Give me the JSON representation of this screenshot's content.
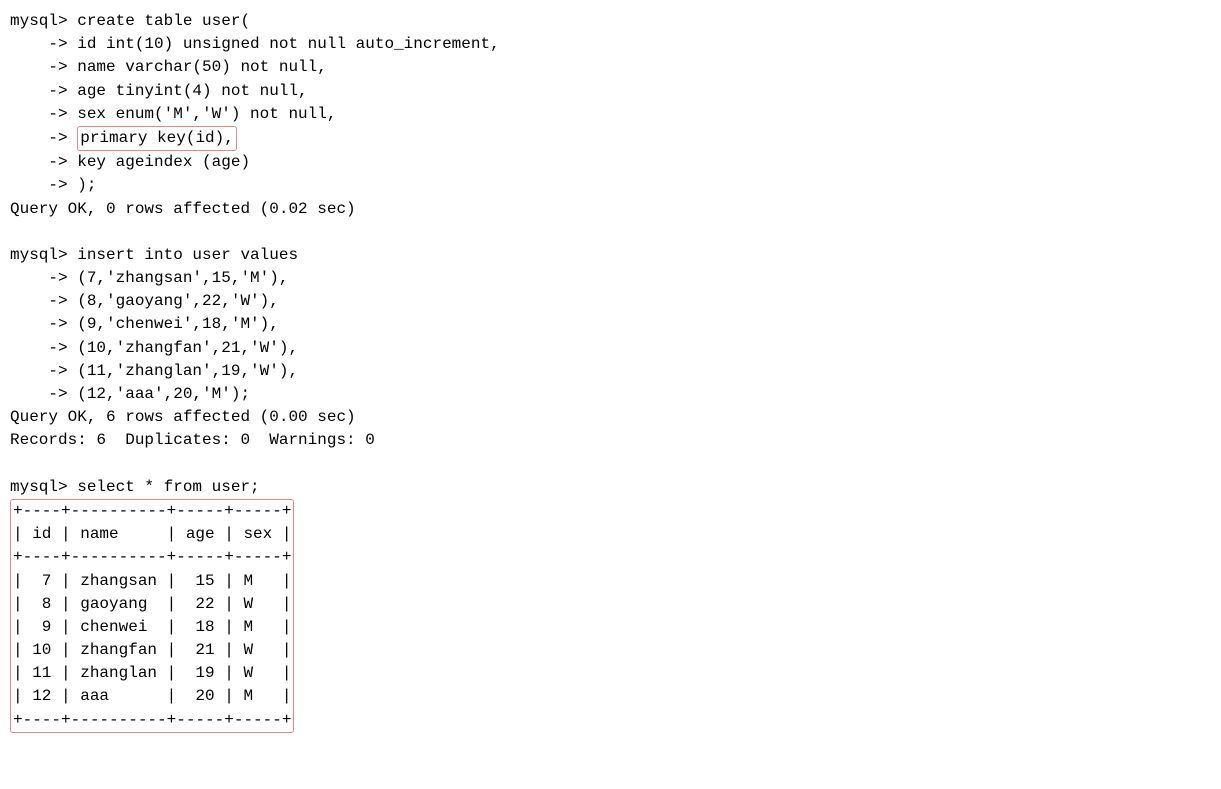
{
  "prompt": "mysql>",
  "cont": "    ->",
  "create": {
    "line1": "mysql> create table user(",
    "line2": "    -> id int(10) unsigned not null auto_increment,",
    "line3": "    -> name varchar(50) not null,",
    "line4": "    -> age tinyint(4) not null,",
    "line5": "    -> sex enum('M','W') not null,",
    "line6_prefix": "    -> ",
    "line6_boxed": "primary key(id),",
    "line7": "    -> key ageindex (age)",
    "line8": "    -> );",
    "result": "Query OK, 0 rows affected (0.02 sec)"
  },
  "insert": {
    "line1": "mysql> insert into user values",
    "line2": "    -> (7,'zhangsan',15,'M'),",
    "line3": "    -> (8,'gaoyang',22,'W'),",
    "line4": "    -> (9,'chenwei',18,'M'),",
    "line5": "    -> (10,'zhangfan',21,'W'),",
    "line6": "    -> (11,'zhanglan',19,'W'),",
    "line7": "    -> (12,'aaa',20,'M');",
    "result1": "Query OK, 6 rows affected (0.00 sec)",
    "result2": "Records: 6  Duplicates: 0  Warnings: 0"
  },
  "select": {
    "query": "mysql> select * from user;",
    "border": "+----+----------+-----+-----+",
    "header": "| id | name     | age | sex |",
    "rows": [
      "|  7 | zhangsan |  15 | M   |",
      "|  8 | gaoyang  |  22 | W   |",
      "|  9 | chenwei  |  18 | M   |",
      "| 10 | zhangfan |  21 | W   |",
      "| 11 | zhanglan |  19 | W   |",
      "| 12 | aaa      |  20 | M   |"
    ],
    "data": [
      {
        "id": 7,
        "name": "zhangsan",
        "age": 15,
        "sex": "M"
      },
      {
        "id": 8,
        "name": "gaoyang",
        "age": 22,
        "sex": "W"
      },
      {
        "id": 9,
        "name": "chenwei",
        "age": 18,
        "sex": "M"
      },
      {
        "id": 10,
        "name": "zhangfan",
        "age": 21,
        "sex": "W"
      },
      {
        "id": 11,
        "name": "zhanglan",
        "age": 19,
        "sex": "W"
      },
      {
        "id": 12,
        "name": "aaa",
        "age": 20,
        "sex": "M"
      }
    ]
  }
}
